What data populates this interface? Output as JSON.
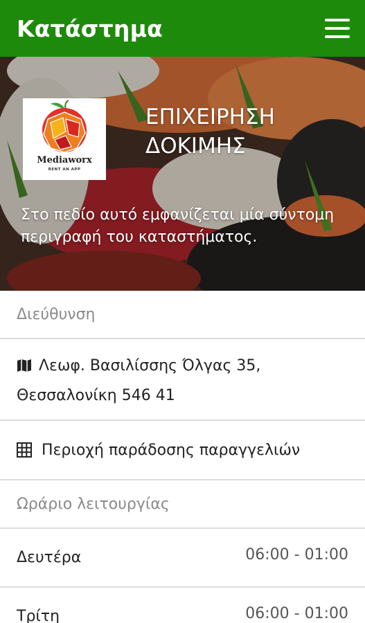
{
  "app_bar": {
    "title": "Κατάστημα",
    "menu_icon": "hamburger-menu-icon",
    "color": "#1e8a0c"
  },
  "hero": {
    "logo_text": "Mediaworx",
    "logo_tagline": "RENT AN APP",
    "business_name_line1": "ΕΠΙΧΕΙΡΗΣΗ",
    "business_name_line2": "ΔΟΚΙΜΗΣ",
    "description": "Στο πεδίο αυτό εμφανίζεται μία σύντομη περιγραφή του καταστήματος."
  },
  "address_section": {
    "header": "Διεύθυνση",
    "icon": "map-icon",
    "line1": "Λεωφ. Βασιλίσσης Όλγας 35,",
    "line2": "Θεσσαλονίκη 546 41"
  },
  "delivery": {
    "icon": "grid-icon",
    "label": "Περιοχή παράδοσης παραγγελιών"
  },
  "hours_section": {
    "header": "Ωράριο λειτουργίας",
    "rows": [
      {
        "day": "Δευτέρα",
        "time": "06:00 - 01:00"
      },
      {
        "day": "Τρίτη",
        "time": "06:00 - 01:00"
      }
    ]
  }
}
